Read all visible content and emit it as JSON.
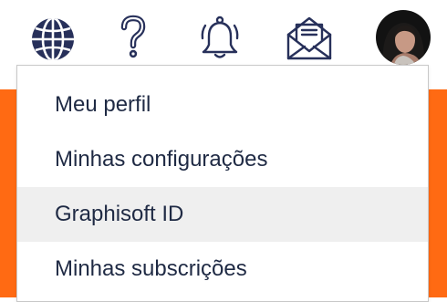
{
  "header": {
    "icons": [
      {
        "name": "globe-icon"
      },
      {
        "name": "help-icon"
      },
      {
        "name": "bell-icon"
      },
      {
        "name": "mail-icon"
      }
    ],
    "avatar": {
      "name": "user-avatar"
    }
  },
  "menu": {
    "items": [
      {
        "label": "Meu perfil"
      },
      {
        "label": "Minhas configurações"
      },
      {
        "label": "Graphisoft ID",
        "highlighted": true
      },
      {
        "label": "Minhas subscrições"
      }
    ]
  },
  "colors": {
    "icon": "#27305a",
    "accent": "#ff6a13",
    "text": "#1f2a44",
    "highlight": "#efefef"
  }
}
